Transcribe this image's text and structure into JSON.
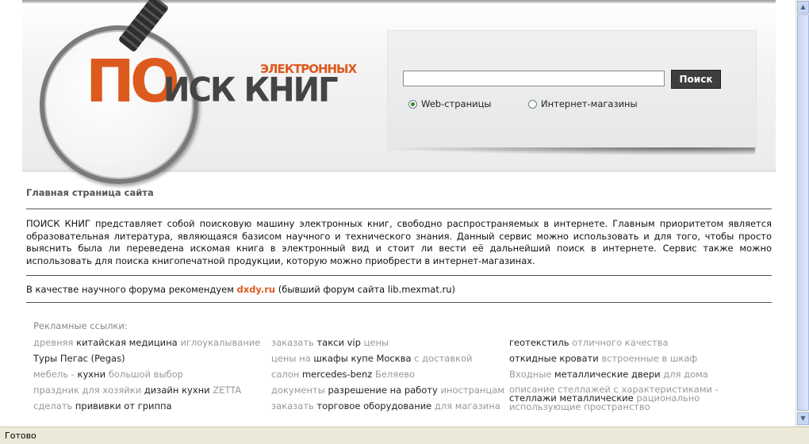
{
  "logo": {
    "big": "ПО",
    "word": "ИСК КНИГ",
    "small": "ЭЛЕКТРОННЫХ"
  },
  "search": {
    "value": "",
    "button_label": "Поиск",
    "options": [
      {
        "label": "Web-страницы",
        "selected": true
      },
      {
        "label": "Интернет-магазины",
        "selected": false
      }
    ]
  },
  "main": {
    "heading": "Главная страница сайта",
    "intro": "ПОИСК КНИГ представляет собой поисковую машину электронных книг, свободно распространяемых в интернете. Главным приоритетом является образовательная литература, являющаяся базисом научного и технического знания. Данный сервис можно использовать и для того, чтобы просто выяснить была ли переведена искомая книга в электронный вид и стоит ли вести её дальнейший поиск в интернете. Сервис также можно использовать для поиска книгопечатной продукции, которую можно приобрести в интернет-магазинах.",
    "forum_prefix": "В качестве научного форума рекомендуем ",
    "forum_link": "dxdy.ru",
    "forum_suffix": " (бывший форум сайта lib.mexmat.ru)"
  },
  "ads": {
    "title": "Рекламные ссылки:",
    "col1": [
      {
        "pre": "древняя ",
        "key": "китайская медицина",
        "post": " иглоукалывание"
      },
      {
        "pre": "",
        "key": "Туры Пегас (Pegas)",
        "post": ""
      },
      {
        "pre": "мебель - ",
        "key": "кухни",
        "post": " большой выбор"
      },
      {
        "pre": "праздник для хозяйки ",
        "key": "дизайн кухни",
        "post": " ZETTA"
      },
      {
        "pre": "сделать ",
        "key": "прививки от гриппа",
        "post": ""
      }
    ],
    "col2": [
      {
        "pre": "заказать ",
        "key": "такси vip",
        "post": " цены"
      },
      {
        "pre": "цены на ",
        "key": "шкафы купе Москва",
        "post": " с доставкой"
      },
      {
        "pre": "салон ",
        "key": "mercedes-benz",
        "post": " Беляево"
      },
      {
        "pre": "документы ",
        "key": "разрешение на работу",
        "post": " иностранцам"
      },
      {
        "pre": "заказать ",
        "key": "торговое оборудование",
        "post": " для магазина"
      }
    ],
    "col3": [
      {
        "pre": "",
        "key": "геотекстиль",
        "post": " отличного качества"
      },
      {
        "pre": "",
        "key": "откидные кровати",
        "post": " встроенные в шкаф"
      },
      {
        "pre": "Входные ",
        "key": "металлические двери",
        "post": " для дома"
      },
      {
        "pre": "описание стеллажей с характеристиками - ",
        "key": "стеллажи металлические",
        "post": " рационально использующие пространство"
      }
    ]
  },
  "status": {
    "text": "Готово"
  }
}
